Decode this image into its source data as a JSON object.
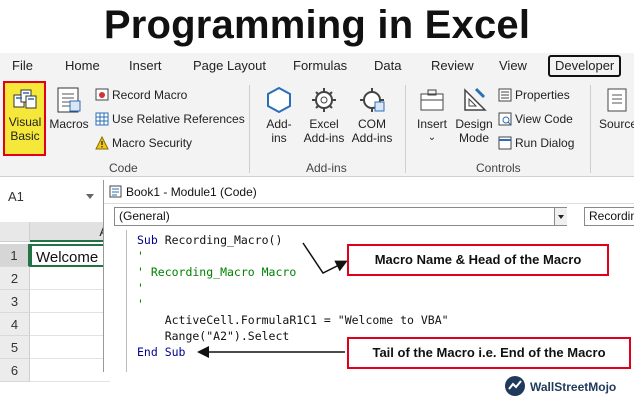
{
  "title": "Programming in Excel",
  "tabs": [
    "File",
    "Home",
    "Insert",
    "Page Layout",
    "Formulas",
    "Data",
    "Review",
    "View",
    "Developer"
  ],
  "ribbon": {
    "visual_basic": [
      "Visual",
      "Basic"
    ],
    "macros": "Macros",
    "record_macro": "Record Macro",
    "use_relative": "Use Relative References",
    "macro_security": "Macro Security",
    "code_group": "Code",
    "addins": [
      "Add-",
      "ins"
    ],
    "excel_addins": [
      "Excel",
      "Add-ins"
    ],
    "com_addins": [
      "COM",
      "Add-ins"
    ],
    "addins_group": "Add-ins",
    "insert": "Insert",
    "design_mode": [
      "Design",
      "Mode"
    ],
    "properties": "Properties",
    "view_code": "View Code",
    "run_dialog": "Run Dialog",
    "controls_group": "Controls",
    "source": "Source"
  },
  "namebox": "A1",
  "grid": {
    "column": "A",
    "rows": [
      "1",
      "2",
      "3",
      "4",
      "5",
      "6"
    ],
    "a1": "Welcome"
  },
  "vbe": {
    "title": "Book1 - Module1 (Code)",
    "combo_left": "(General)",
    "combo_right": "Recording",
    "code": {
      "l1_kw": "Sub",
      "l1_rest": " Recording_Macro()",
      "l2": "'",
      "l3": "' Recording_Macro Macro",
      "l4": "'",
      "l5": "'",
      "l6": "    ActiveCell.FormulaR1C1 = \"Welcome to VBA\"",
      "l7": "    Range(\"A2\").Select",
      "l8": "End Sub"
    }
  },
  "callouts": {
    "head": "Macro Name & Head of the Macro",
    "tail": "Tail of the Macro i.e. End of the Macro"
  },
  "brand": "WallStreetMojo",
  "colors": {
    "highlight": "#f5e83a",
    "callout_border": "#e0001b",
    "excel_green": "#217346",
    "vba_keyword": "#00008b",
    "vba_comment": "#008000"
  }
}
